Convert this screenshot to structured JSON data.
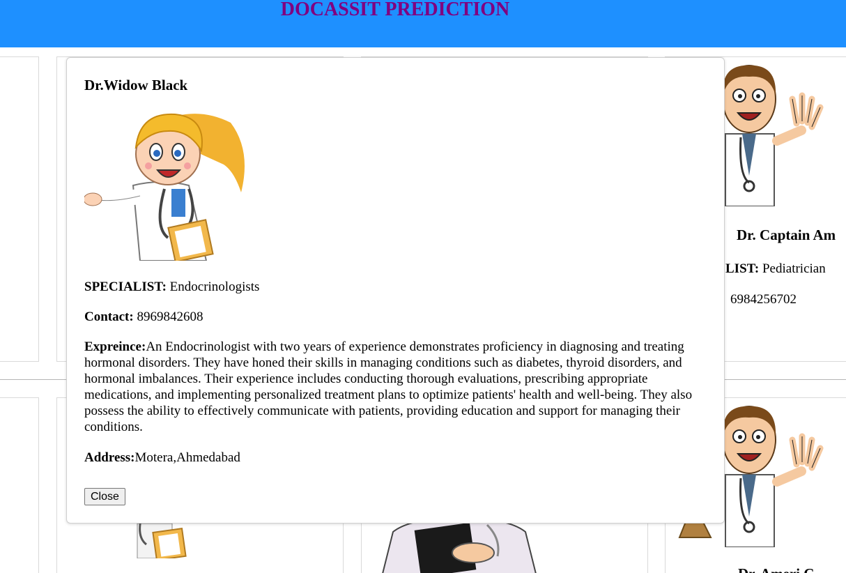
{
  "header": {
    "title": "DOCASSIT PREDICTION"
  },
  "background_cards": {
    "right_top": {
      "name": "Dr. Captain Am",
      "specialist_label": "LIST:",
      "specialist_value": "Pediatrician",
      "contact_value": "6984256702"
    },
    "right_bottom": {
      "name": "Dr. Ameri C"
    }
  },
  "modal": {
    "doctor_name": "Dr.Widow Black",
    "specialist_label": "SPECIALIST:",
    "specialist_value": "Endocrinologists",
    "contact_label": "Contact:",
    "contact_value": "8969842608",
    "experience_label": "Expreince:",
    "experience_value": "An Endocrinologist with two years of experience demonstrates proficiency in diagnosing and treating hormonal disorders. They have honed their skills in managing conditions such as diabetes, thyroid disorders, and hormonal imbalances. Their experience includes conducting thorough evaluations, prescribing appropriate medications, and implementing personalized treatment plans to optimize patients' health and well-being. They also possess the ability to effectively communicate with patients, providing education and support for managing their conditions.",
    "address_label": "Address:",
    "address_value": "Motera,Ahmedabad",
    "close_label": "Close"
  },
  "colors": {
    "header_bg": "#1e90ff",
    "title": "#800080"
  }
}
